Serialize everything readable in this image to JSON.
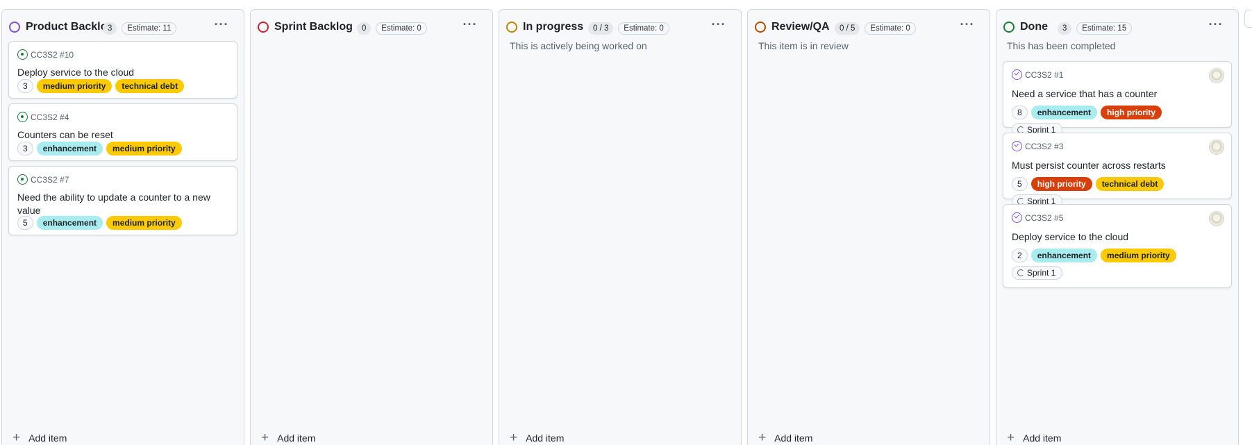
{
  "colors": {
    "product_backlog": "#8250df",
    "sprint_backlog": "#cf222e",
    "in_progress": "#bf8700",
    "review_qa": "#bc4c00",
    "done": "#1a7f37",
    "enhancement_bg": "#a8ecef",
    "medium_priority_bg": "#fbca04",
    "technical_debt_bg": "#fbca04",
    "high_priority_bg": "#d93f0b"
  },
  "board": {
    "add_item_label": "Add item",
    "columns": [
      {
        "title": "Product Backlog",
        "count": "3",
        "estimate": "Estimate: 11",
        "description": "",
        "cards": [
          {
            "ref": "CC3S2 #10",
            "title": "Deploy service to the cloud",
            "estimate": "3",
            "labels": [
              "medium priority",
              "technical debt"
            ],
            "sprint": ""
          },
          {
            "ref": "CC3S2 #4",
            "title": "Counters can be reset",
            "estimate": "3",
            "labels": [
              "enhancement",
              "medium priority"
            ],
            "sprint": ""
          },
          {
            "ref": "CC3S2 #7",
            "title": "Need the ability to update a counter to a new value",
            "estimate": "5",
            "labels": [
              "enhancement",
              "medium priority"
            ],
            "sprint": ""
          }
        ]
      },
      {
        "title": "Sprint Backlog",
        "count": "0",
        "estimate": "Estimate: 0",
        "description": "",
        "cards": []
      },
      {
        "title": "In progress",
        "count": "0 / 3",
        "estimate": "Estimate: 0",
        "description": "This is actively being worked on",
        "cards": []
      },
      {
        "title": "Review/QA",
        "count": "0 / 5",
        "estimate": "Estimate: 0",
        "description": "This item is in review",
        "cards": []
      },
      {
        "title": "Done",
        "count": "3",
        "estimate": "Estimate: 15",
        "description": "This has been completed",
        "cards": [
          {
            "ref": "CC3S2 #1",
            "title": "Need a service that has a counter",
            "estimate": "8",
            "labels": [
              "enhancement",
              "high priority"
            ],
            "sprint": "Sprint 1"
          },
          {
            "ref": "CC3S2 #3",
            "title": "Must persist counter across restarts",
            "estimate": "5",
            "labels": [
              "high priority",
              "technical debt"
            ],
            "sprint": "Sprint 1"
          },
          {
            "ref": "CC3S2 #5",
            "title": "Deploy service to the cloud",
            "estimate": "2",
            "labels": [
              "enhancement",
              "medium priority"
            ],
            "sprint": "Sprint 1"
          }
        ]
      }
    ]
  }
}
